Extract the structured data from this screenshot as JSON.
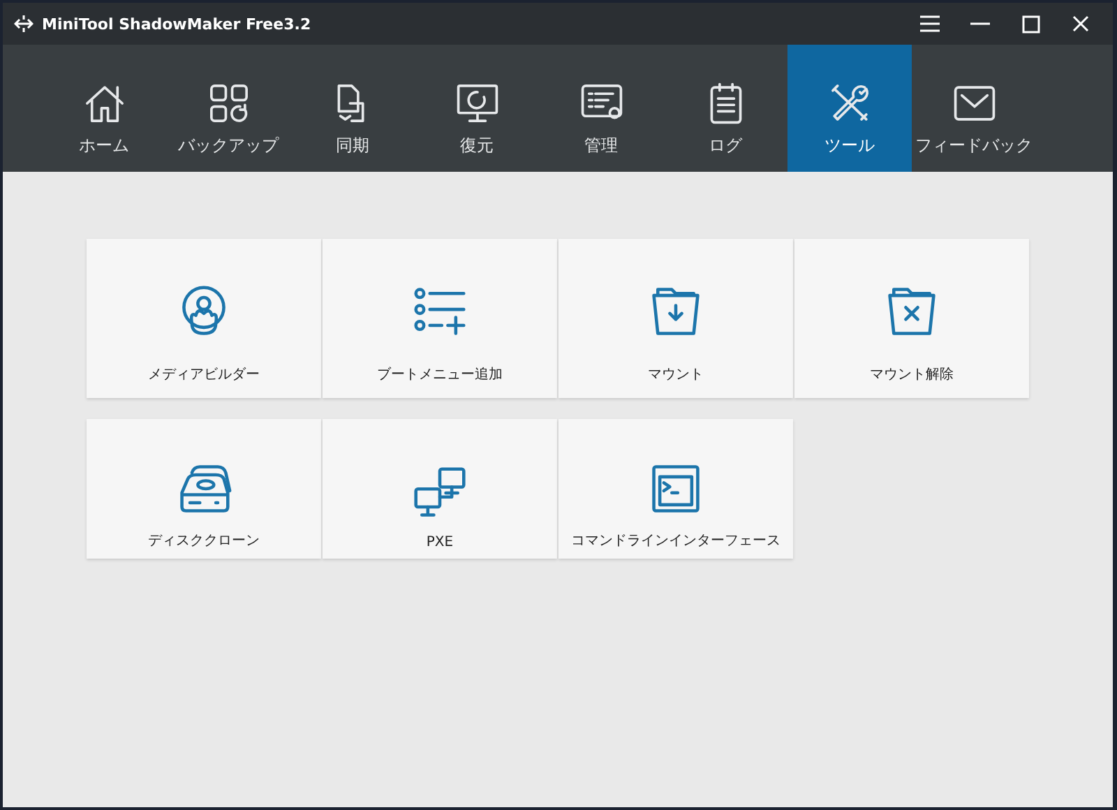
{
  "window": {
    "title": "MiniTool ShadowMaker Free3.2"
  },
  "tabs": [
    {
      "label": "ホーム",
      "selected": false
    },
    {
      "label": "バックアップ",
      "selected": false
    },
    {
      "label": "同期",
      "selected": false
    },
    {
      "label": "復元",
      "selected": false
    },
    {
      "label": "管理",
      "selected": false
    },
    {
      "label": "ログ",
      "selected": false
    },
    {
      "label": "ツール",
      "selected": true
    },
    {
      "label": "フィードバック",
      "selected": false
    }
  ],
  "tools": [
    {
      "label": "メディアビルダー"
    },
    {
      "label": "ブートメニュー追加"
    },
    {
      "label": "マウント"
    },
    {
      "label": "マウント解除"
    },
    {
      "label": "ディスククローン"
    },
    {
      "label": "PXE"
    },
    {
      "label": "コマンドラインインターフェース"
    }
  ]
}
